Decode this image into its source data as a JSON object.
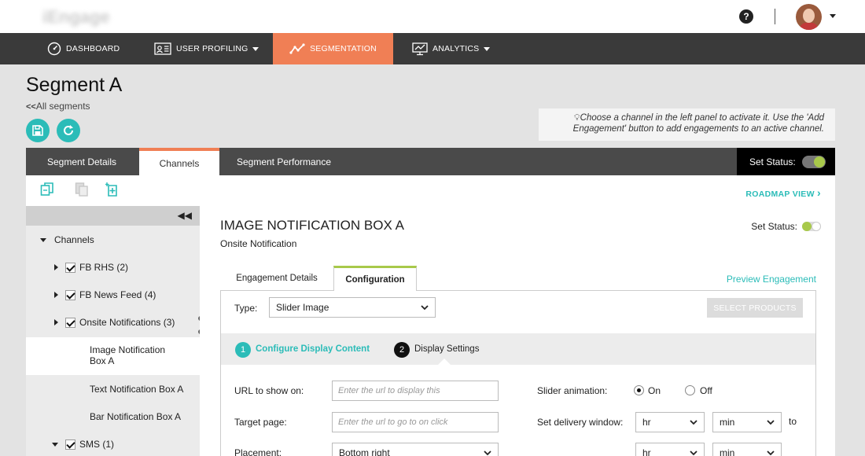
{
  "brand": {
    "logo_text": "iEngage"
  },
  "header": {
    "help_label": "?"
  },
  "nav": {
    "items": [
      {
        "label": "DASHBOARD",
        "icon": "dashboard-icon"
      },
      {
        "label": "USER PROFILING",
        "icon": "id-card-icon"
      },
      {
        "label": "SEGMENTATION",
        "icon": "trend-line-icon"
      },
      {
        "label": "ANALYTICS",
        "icon": "monitor-chart-icon"
      }
    ],
    "active": "SEGMENTATION"
  },
  "page": {
    "title": "Segment A",
    "back_link": "All segments",
    "back_glyph": "<<",
    "hint": "Choose a channel in the left panel to activate it. Use the 'Add Engagement' button  to add engagements to an active channel."
  },
  "tabs": {
    "items": [
      "Segment Details",
      "Channels",
      "Segment Performance"
    ],
    "active": "Channels",
    "set_status_label": "Set Status:"
  },
  "toolbar": {
    "roadmap_label": "ROADMAP VIEW",
    "roadmap_glyph": "›"
  },
  "tree": {
    "collapse_glyph": "◀◀",
    "root_label": "Channels",
    "items": [
      {
        "label": "FB RHS (2)"
      },
      {
        "label": "FB News Feed (4)"
      },
      {
        "label": "Onsite Notifications (3)"
      },
      {
        "label": "Image Notification Box A",
        "label_line1": "Image Notification",
        "label_line2": "Box A"
      },
      {
        "label": "Text Notification Box A"
      },
      {
        "label": "Bar Notification Box A"
      },
      {
        "label": "SMS (1)"
      }
    ]
  },
  "detail": {
    "title": "IMAGE NOTIFICATION BOX A",
    "subtitle": "Onsite Notification",
    "set_status_label": "Set Status:",
    "subtabs": [
      "Engagement Details",
      "Configuration"
    ],
    "active_subtab": "Configuration",
    "preview_label": "Preview Engagement",
    "type_label": "Type:",
    "type_value": "Slider Image",
    "select_products_label": "SELECT PRODUCTS",
    "steps": [
      {
        "num": "1",
        "label": "Configure Display Content",
        "color": "#2bbcb8"
      },
      {
        "num": "2",
        "label": "Display Settings",
        "color": "#111111"
      }
    ],
    "url_label": "URL to show on:",
    "url_placeholder": "Enter the url to display this",
    "target_label": "Target page:",
    "target_placeholder": "Enter the url to go to on click",
    "placement_label": "Placement:",
    "placement_value": "Bottom right",
    "slider_anim_label": "Slider animation:",
    "on_label": "On",
    "off_label": "Off",
    "delivery_label": "Set delivery window:",
    "hr_label": "hr",
    "min_label": "min",
    "to_label": "to"
  },
  "colors": {
    "accent": "#f07f55",
    "teal": "#2bbcb8",
    "green": "#a8c94a",
    "nav_bg": "#3a3a3a"
  }
}
